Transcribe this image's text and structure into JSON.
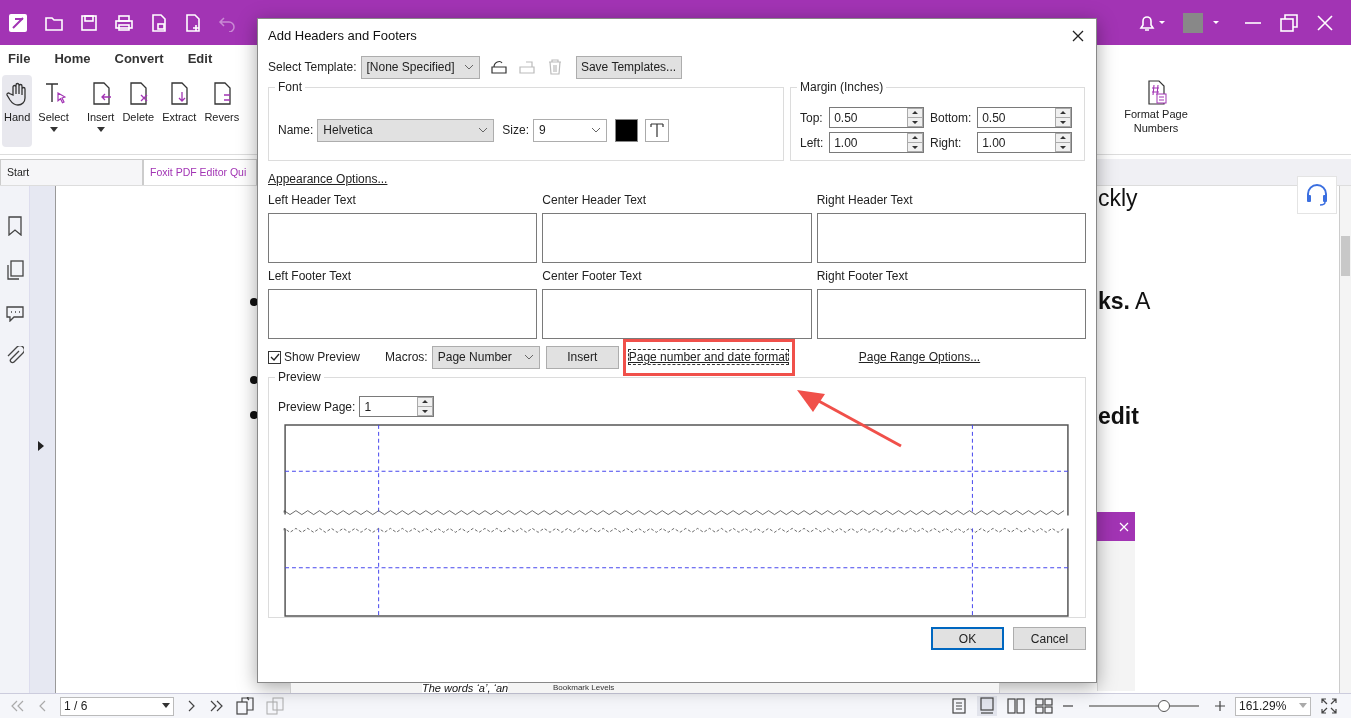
{
  "app": {
    "menu": [
      {
        "label": "File",
        "selected": false
      },
      {
        "label": "Home",
        "selected": false
      },
      {
        "label": "Convert",
        "selected": false
      },
      {
        "label": "Edit",
        "selected": false
      }
    ],
    "ribbon": [
      {
        "label": "Hand",
        "selected": true,
        "dropdown": false
      },
      {
        "label": "Select",
        "selected": false,
        "dropdown": true
      },
      {
        "label": "Insert",
        "selected": false,
        "dropdown": true
      },
      {
        "label": "Delete",
        "selected": false,
        "dropdown": false
      },
      {
        "label": "Extract",
        "selected": false,
        "dropdown": false
      },
      {
        "label": "Revers",
        "selected": false,
        "dropdown": false
      }
    ],
    "ribbon_right": [
      {
        "label": "Format Page Numbers"
      }
    ],
    "doc_tabs": [
      {
        "label": "Start",
        "selected": false
      },
      {
        "label": "Foxit PDF Editor Qui",
        "selected": true
      }
    ],
    "document": {
      "fragments": [
        {
          "text": "ckly"
        },
        {
          "text": "**ks.** A"
        },
        {
          "text": "**edit**"
        }
      ],
      "inner_caption": "The words ‘a’, ‘an",
      "inner_label": "Bookmark Levels"
    },
    "status": {
      "page": "1 / 6",
      "zoom": "161.29%",
      "zoom_slider": {
        "level": 0.68
      }
    }
  },
  "dialog": {
    "title": "Add Headers and Footers",
    "template": {
      "label": "Select Template:",
      "value": "[None Specified]",
      "save": "Save Templates..."
    },
    "font": {
      "legend": "Font",
      "name_label": "Name:",
      "name": "Helvetica",
      "size_label": "Size:",
      "size": "9",
      "color": "#000000"
    },
    "margin": {
      "legend": "Margin (Inches)",
      "fields": [
        {
          "label": "Top:",
          "value": "0.50"
        },
        {
          "label": "Bottom:",
          "value": "0.50"
        },
        {
          "label": "Left:",
          "value": "1.00"
        },
        {
          "label": "Right:",
          "value": "1.00"
        }
      ]
    },
    "appearance_link": "Appearance Options...",
    "headers": [
      {
        "label": "Left Header Text"
      },
      {
        "label": "Center Header Text"
      },
      {
        "label": "Right Header Text"
      }
    ],
    "footers": [
      {
        "label": "Left Footer Text"
      },
      {
        "label": "Center Footer Text"
      },
      {
        "label": "Right Footer Text"
      }
    ],
    "show_preview": {
      "label": "Show Preview",
      "checked": true
    },
    "macros": {
      "label": "Macros:",
      "value": "Page Number",
      "insert": "Insert"
    },
    "format_link": {
      "label": "Page number and date format",
      "highlighted": true
    },
    "range_link": "Page Range Options...",
    "preview": {
      "legend": "Preview",
      "page_label": "Preview Page:",
      "page": "1"
    },
    "buttons": [
      {
        "label": "OK",
        "default": true
      },
      {
        "label": "Cancel",
        "default": false
      }
    ]
  }
}
